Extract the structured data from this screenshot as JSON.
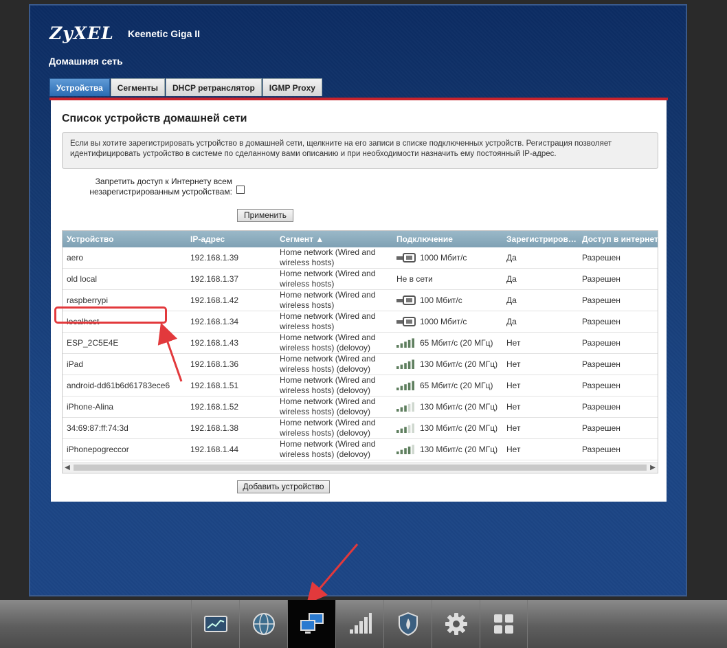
{
  "header": {
    "brand": "ZyXEL",
    "model": "Keenetic Giga II"
  },
  "section_title": "Домашняя сеть",
  "tabs": [
    {
      "label": "Устройства",
      "active": true
    },
    {
      "label": "Сегменты",
      "active": false
    },
    {
      "label": "DHCP ретранслятор",
      "active": false
    },
    {
      "label": "IGMP Proxy",
      "active": false
    }
  ],
  "panel": {
    "title": "Список устройств домашней сети",
    "info": "Если вы хотите зарегистрировать устройство в домашней сети, щелкните на его записи в списке подключенных устройств. Регистрация позволяет идентифицировать устройство в системе по сделанному вами описанию и при необходимости назначить ему постоянный IP-адрес.",
    "block_label_line1": "Запретить доступ к Интернету всем",
    "block_label_line2": "незарегистрированным устройствам:",
    "block_checked": false,
    "apply_label": "Применить",
    "add_label": "Добавить устройство"
  },
  "table": {
    "columns": [
      "Устройство",
      "IP-адрес",
      "Сегмент ▲",
      "Подключение",
      "Зарегистриров…",
      "Доступ в интернет"
    ],
    "rows": [
      {
        "device": "aero",
        "ip": "192.168.1.39",
        "segment": "Home network (Wired and wireless hosts)",
        "conn_icon": "ethernet-icon",
        "connection": "1000 Мбит/с",
        "registered": "Да",
        "access": "Разрешен"
      },
      {
        "device": "old local",
        "ip": "192.168.1.37",
        "segment": "Home network (Wired and wireless hosts)",
        "conn_icon": "",
        "connection": "Не в сети",
        "registered": "Да",
        "access": "Разрешен"
      },
      {
        "device": "raspberrypi",
        "ip": "192.168.1.42",
        "segment": "Home network (Wired and wireless hosts)",
        "conn_icon": "ethernet-icon",
        "connection": "100 Мбит/с",
        "registered": "Да",
        "access": "Разрешен"
      },
      {
        "device": "localhost",
        "ip": "192.168.1.34",
        "segment": "Home network (Wired and wireless hosts)",
        "conn_icon": "ethernet-icon",
        "connection": "1000 Мбит/с",
        "registered": "Да",
        "access": "Разрешен"
      },
      {
        "device": "ESP_2C5E4E",
        "ip": "192.168.1.43",
        "segment": "Home network (Wired and wireless hosts) (delovoy)",
        "conn_icon": "wifi-signal-icon",
        "signal_bars": 5,
        "connection": "65 Мбит/с (20 МГц)",
        "registered": "Нет",
        "access": "Разрешен"
      },
      {
        "device": "iPad",
        "ip": "192.168.1.36",
        "segment": "Home network (Wired and wireless hosts) (delovoy)",
        "conn_icon": "wifi-signal-icon",
        "signal_bars": 5,
        "connection": "130 Мбит/с (20 МГц)",
        "registered": "Нет",
        "access": "Разрешен"
      },
      {
        "device": "android-dd61b6d61783ece6",
        "ip": "192.168.1.51",
        "segment": "Home network (Wired and wireless hosts) (delovoy)",
        "conn_icon": "wifi-signal-icon",
        "signal_bars": 5,
        "connection": "65 Мбит/с (20 МГц)",
        "registered": "Нет",
        "access": "Разрешен"
      },
      {
        "device": "iPhone-Alina",
        "ip": "192.168.1.52",
        "segment": "Home network (Wired and wireless hosts) (delovoy)",
        "conn_icon": "wifi-signal-icon",
        "signal_bars": 3,
        "connection": "130 Мбит/с (20 МГц)",
        "registered": "Нет",
        "access": "Разрешен"
      },
      {
        "device": "34:69:87:ff:74:3d",
        "ip": "192.168.1.38",
        "segment": "Home network (Wired and wireless hosts) (delovoy)",
        "conn_icon": "wifi-signal-icon",
        "signal_bars": 3,
        "connection": "130 Мбит/с (20 МГц)",
        "registered": "Нет",
        "access": "Разрешен"
      },
      {
        "device": "iPhonepogreccor",
        "ip": "192.168.1.44",
        "segment": "Home network (Wired and wireless hosts) (delovoy)",
        "conn_icon": "wifi-signal-icon",
        "signal_bars": 4,
        "connection": "130 Мбит/с (20 МГц)",
        "registered": "Нет",
        "access": "Разрешен"
      }
    ]
  },
  "taskbar": {
    "items": [
      {
        "icon": "monitor-chart-icon",
        "active": false
      },
      {
        "icon": "globe-icon",
        "active": false
      },
      {
        "icon": "home-network-icon",
        "active": true
      },
      {
        "icon": "wifi-bars-icon",
        "active": false
      },
      {
        "icon": "security-shield-icon",
        "active": false
      },
      {
        "icon": "gear-icon",
        "active": false
      },
      {
        "icon": "apps-grid-icon",
        "active": false
      }
    ]
  },
  "colors": {
    "accent_red": "#c8232c",
    "annotation": "#e2393c",
    "tab_active": "#2a6bb2",
    "header_blue": "#14386f"
  }
}
